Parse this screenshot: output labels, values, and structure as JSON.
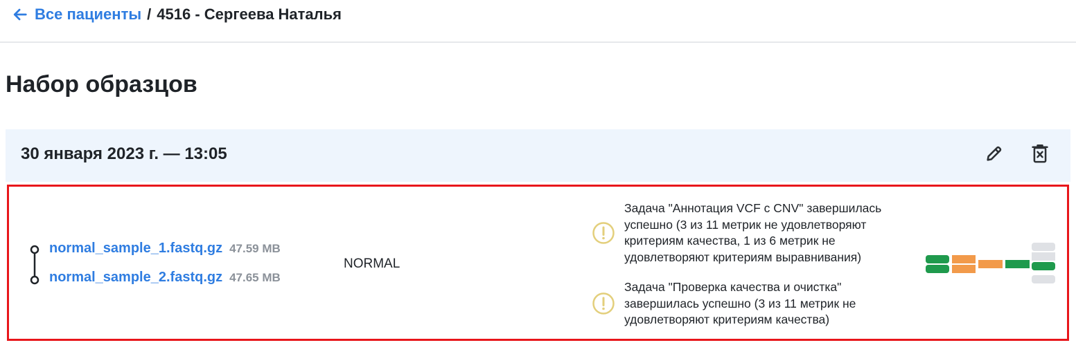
{
  "breadcrumb": {
    "back_label": "Все пациенты",
    "separator": "/",
    "current": "4516 - Сергеева Наталья"
  },
  "page": {
    "title": "Набор образцов"
  },
  "sample_set": {
    "date": "30 января 2023 г. — 13:05",
    "actions": {
      "edit_icon": "pencil-icon",
      "delete_icon": "trash-icon"
    },
    "rows": [
      {
        "files": [
          {
            "name": "normal_sample_1.fastq.gz",
            "size": "47.59 MB"
          },
          {
            "name": "normal_sample_2.fastq.gz",
            "size": "47.65 MB"
          }
        ],
        "type": "NORMAL",
        "tasks": [
          {
            "icon": "warning-icon",
            "text": "Задача \"Аннотация VCF с CNV\" завершилась успешно (3 из 11 метрик не удовлетворяют критериям качества, 1 из 6 метрик не удовлетворяют критериям выравнивания)"
          },
          {
            "icon": "warning-icon",
            "text": "Задача \"Проверка качества и очистка\" завершилась успешно (3 из 11 метрик не удовлетворяют критериям качества)"
          }
        ],
        "pipeline_status_icon": "pipeline-progress-icon"
      }
    ]
  },
  "colors": {
    "link": "#2f7de1",
    "header_bg": "#eef5fd",
    "highlight_border": "#e8161b",
    "warning": "#e3cf7c",
    "step_success": "#1f9a4d",
    "step_warning": "#f29a4a",
    "step_pending": "#dfe1e5"
  }
}
